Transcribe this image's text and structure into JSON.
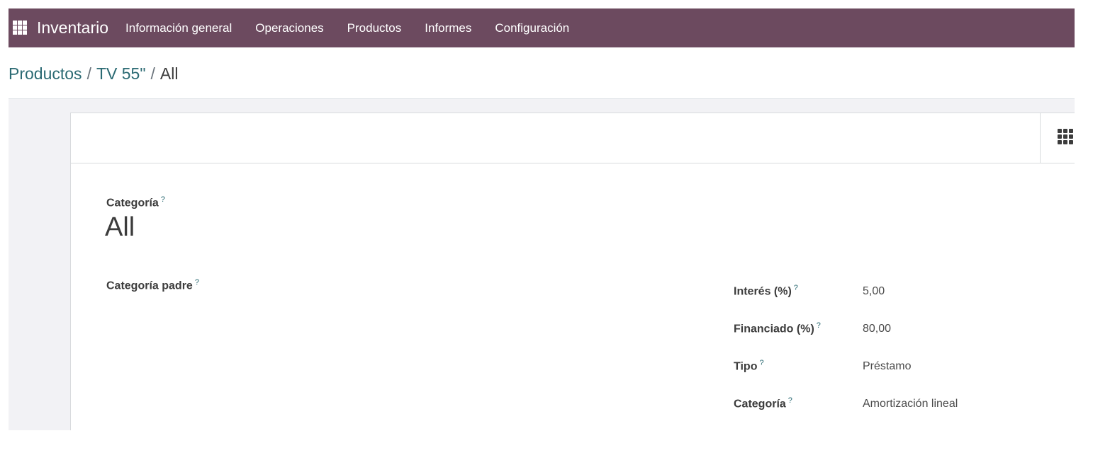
{
  "navbar": {
    "apps_icon": "apps-grid-icon",
    "brand": "Inventario",
    "menu": [
      "Información general",
      "Operaciones",
      "Productos",
      "Informes",
      "Configuración"
    ],
    "color": "#6c4a5f"
  },
  "breadcrumb": {
    "items": [
      "Productos",
      "TV 55\""
    ],
    "separator": "/",
    "current": "All"
  },
  "toolbar": {
    "more_icon": "grid-icon"
  },
  "form": {
    "help_mark": "?",
    "title_label": "Categoría",
    "title_value": "All",
    "parent_label": "Categoría padre",
    "parent_value": "",
    "fields": [
      {
        "label": "Interés (%)",
        "value": "5,00"
      },
      {
        "label": "Financiado (%)",
        "value": "80,00"
      },
      {
        "label": "Tipo",
        "value": "Préstamo"
      },
      {
        "label": "Categoría",
        "value": "Amortización lineal"
      }
    ]
  }
}
